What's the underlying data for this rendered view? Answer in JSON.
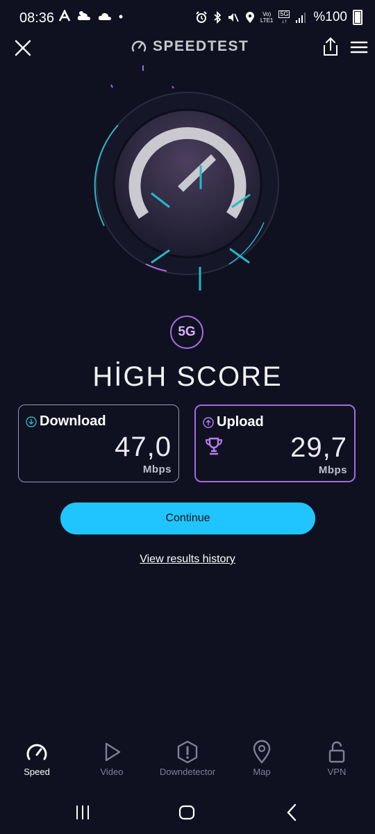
{
  "status_bar": {
    "time": "08:36",
    "left_icons": [
      "a-logo-icon",
      "cloud-icon",
      "cloud-icon",
      "dot-icon"
    ],
    "right_icons": [
      "alarm-icon",
      "bluetooth-icon",
      "mute-icon",
      "location-icon",
      "volte-icon",
      "5g-icon",
      "signal-icon"
    ],
    "volte_text": "Vo)",
    "lte_text": "LTE1",
    "fiveg_text": "5G",
    "battery_text": "%100"
  },
  "header": {
    "title": "SPEEDTEST"
  },
  "network_badge": "5G",
  "headline": "HİGH SCORE",
  "download": {
    "label": "Download",
    "value": "47,0",
    "unit": "Mbps"
  },
  "upload": {
    "label": "Upload",
    "value": "29,7",
    "unit": "Mbps"
  },
  "continue_label": "Continue",
  "history_link": "View results history",
  "bottom_nav": {
    "items": [
      {
        "label": "Speed",
        "icon": "speedometer-icon",
        "active": true
      },
      {
        "label": "Video",
        "icon": "play-icon",
        "active": false
      },
      {
        "label": "Downdetector",
        "icon": "alert-icon",
        "active": false
      },
      {
        "label": "Map",
        "icon": "map-pin-icon",
        "active": false
      },
      {
        "label": "VPN",
        "icon": "lock-icon",
        "active": false
      }
    ]
  },
  "colors": {
    "background": "#0f1120",
    "accent_blue": "#20c5ff",
    "accent_purple": "#a36be0",
    "teal": "#27b7c8"
  }
}
